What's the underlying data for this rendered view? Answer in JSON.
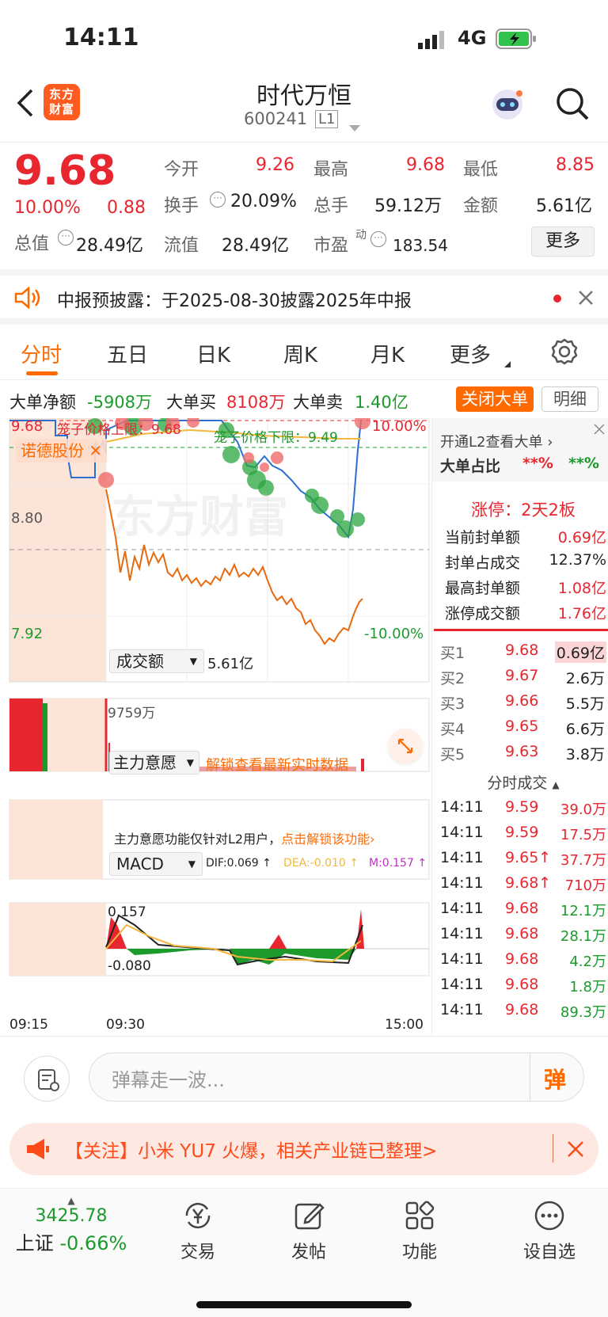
{
  "status": {
    "time": "14:11",
    "network": "4G"
  },
  "nav": {
    "title": "时代万恒",
    "code": "600241",
    "level": "L1",
    "logo": "东方财富"
  },
  "quote": {
    "price": "9.68",
    "pct": "10.00%",
    "chg": "0.88",
    "open_label": "今开",
    "open": "9.26",
    "high_label": "最高",
    "high": "9.68",
    "low_label": "最低",
    "low": "8.85",
    "turn_label": "换手",
    "turn": "20.09%",
    "vol_label": "总手",
    "vol": "59.12万",
    "amt_label": "金额",
    "amt": "5.61亿",
    "mcap_label": "总值",
    "mcap": "28.49亿",
    "float_label": "流值",
    "float": "28.49亿",
    "pe_label": "市盈",
    "pe_sup": "动",
    "pe": "183.54",
    "more": "更多"
  },
  "notice": {
    "text": "中报预披露：于2025-08-30披露2025年中报"
  },
  "tabs": {
    "t1": "分时",
    "t2": "五日",
    "t3": "日K",
    "t4": "周K",
    "t5": "月K",
    "t6": "更多"
  },
  "bigorder": {
    "net_label": "大单净额",
    "net": "-5908万",
    "buy_label": "大单买",
    "buy": "8108万",
    "sell_label": "大单卖",
    "sell": "1.40亿",
    "close_btn": "关闭大单",
    "detail_btn": "明细"
  },
  "chart": {
    "top_price": "9.68",
    "mid_price": "8.80",
    "bot_price": "7.92",
    "top_pct": "10.00%",
    "bot_pct": "-10.00%",
    "cage_up": "笼子价格上限：9.68",
    "cage_down": "笼子价格下限：9.49",
    "tag": "诺德股份",
    "watermark": "东方财富",
    "vol_label": "成交额",
    "vol_total": "5.61亿",
    "vol_max": "9759万",
    "main_label": "主力意愿",
    "main_unlock": "解锁查看最新实时数据",
    "main_note": "主力意愿功能仅针对L2用户，",
    "main_link": "点击解锁该功能",
    "macd_label": "MACD",
    "dif": "DIF:0.069 ↑",
    "dea": "DEA:-0.010 ↑",
    "m": "M:0.157 ↑",
    "macd_top": "0.157",
    "macd_bot": "-0.080",
    "t_start": "09:15",
    "t_mid": "09:30",
    "t_end": "15:00"
  },
  "side": {
    "l2": "开通L2查看大单",
    "ratio_label": "大单占比",
    "ratio1": "**%",
    "ratio2": "**%",
    "limit": "涨停：2天2板",
    "seal_label": "当前封单额",
    "seal": "0.69亿",
    "sealratio_label": "封单占成交",
    "sealratio": "12.37%",
    "maxseal_label": "最高封单额",
    "maxseal": "1.08亿",
    "limitamt_label": "涨停成交额",
    "limitamt": "1.76亿",
    "bids": [
      {
        "l": "买1",
        "p": "9.68",
        "v": "0.69亿"
      },
      {
        "l": "买2",
        "p": "9.67",
        "v": "2.6万"
      },
      {
        "l": "买3",
        "p": "9.66",
        "v": "5.5万"
      },
      {
        "l": "买4",
        "p": "9.65",
        "v": "6.6万"
      },
      {
        "l": "买5",
        "p": "9.63",
        "v": "3.8万"
      }
    ],
    "ticks_label": "分时成交",
    "ticks": [
      {
        "t": "14:11",
        "p": "9.59",
        "v": "39.0万"
      },
      {
        "t": "14:11",
        "p": "9.59",
        "v": "17.5万"
      },
      {
        "t": "14:11",
        "p": "9.65↑",
        "v": "37.7万"
      },
      {
        "t": "14:11",
        "p": "9.68↑",
        "v": "710万"
      },
      {
        "t": "14:11",
        "p": "9.68",
        "v": "12.1万"
      },
      {
        "t": "14:11",
        "p": "9.68",
        "v": "28.1万"
      },
      {
        "t": "14:11",
        "p": "9.68",
        "v": "4.2万"
      },
      {
        "t": "14:11",
        "p": "9.68",
        "v": "1.8万"
      },
      {
        "t": "14:11",
        "p": "9.68",
        "v": "89.3万"
      }
    ]
  },
  "bottom": {
    "placeholder": "弹幕走一波...",
    "danmu": "弹"
  },
  "ad": {
    "text": "【关注】小米 YU7 火爆，相关产业链已整理>"
  },
  "tabbar": {
    "index_val": "3425.78",
    "index_name": "上证",
    "index_pct": "-0.66%",
    "t1": "交易",
    "t2": "发帖",
    "t3": "功能",
    "t4": "设自选"
  },
  "colors": {
    "up": "#e8262f",
    "down": "#1c9a2c",
    "accent": "#ff6a00"
  }
}
